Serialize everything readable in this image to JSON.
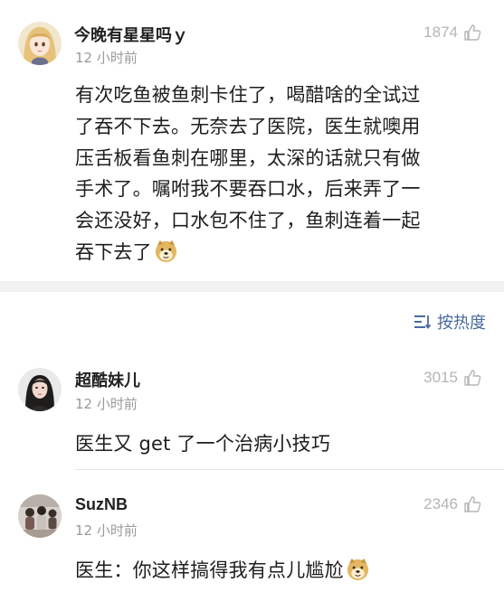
{
  "main_comment": {
    "user": "今晚有星星吗ｙ",
    "time": "12 小时前",
    "likes": "1874",
    "body_lines": [
      "有次吃鱼被鱼刺卡住了，喝醋啥的全试过",
      "了吞不下去。无奈去了医院，医生就噢用",
      "压舌板看鱼刺在哪里，太深的话就只有做",
      "手术了。嘱咐我不要吞口水，后来弄了一",
      "会还没好，口水包不住了，鱼刺连着一起",
      "吞下去了"
    ],
    "emoji": "doge-emoji"
  },
  "sort": {
    "label": "按热度",
    "icon": "sort-icon"
  },
  "replies": [
    {
      "user": "超酷妹儿",
      "time": "12 小时前",
      "likes": "3015",
      "text": "医生又 get 了一个治病小技巧"
    },
    {
      "user": "SuzNB",
      "time": "12 小时前",
      "likes": "2346",
      "text": "医生：你这样搞得我有点儿尴尬",
      "emoji": "doge-emoji"
    }
  ],
  "colors": {
    "link_blue": "#4a6a9c",
    "meta_gray": "#9a9a9a",
    "divider": "#f2f2f2"
  }
}
